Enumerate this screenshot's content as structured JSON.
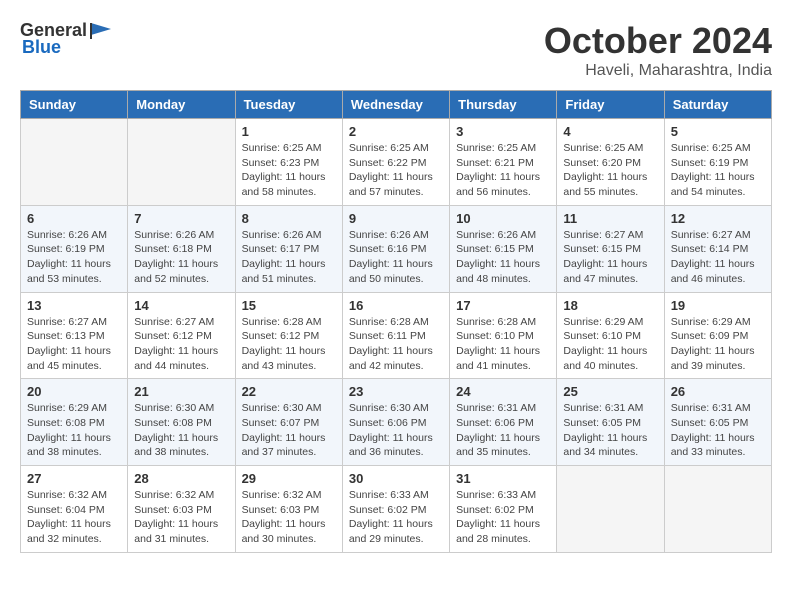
{
  "header": {
    "logo_general": "General",
    "logo_blue": "Blue",
    "title": "October 2024",
    "subtitle": "Haveli, Maharashtra, India"
  },
  "calendar": {
    "weekdays": [
      "Sunday",
      "Monday",
      "Tuesday",
      "Wednesday",
      "Thursday",
      "Friday",
      "Saturday"
    ],
    "weeks": [
      [
        {
          "day": "",
          "sunrise": "",
          "sunset": "",
          "daylight": ""
        },
        {
          "day": "",
          "sunrise": "",
          "sunset": "",
          "daylight": ""
        },
        {
          "day": "1",
          "sunrise": "Sunrise: 6:25 AM",
          "sunset": "Sunset: 6:23 PM",
          "daylight": "Daylight: 11 hours and 58 minutes."
        },
        {
          "day": "2",
          "sunrise": "Sunrise: 6:25 AM",
          "sunset": "Sunset: 6:22 PM",
          "daylight": "Daylight: 11 hours and 57 minutes."
        },
        {
          "day": "3",
          "sunrise": "Sunrise: 6:25 AM",
          "sunset": "Sunset: 6:21 PM",
          "daylight": "Daylight: 11 hours and 56 minutes."
        },
        {
          "day": "4",
          "sunrise": "Sunrise: 6:25 AM",
          "sunset": "Sunset: 6:20 PM",
          "daylight": "Daylight: 11 hours and 55 minutes."
        },
        {
          "day": "5",
          "sunrise": "Sunrise: 6:25 AM",
          "sunset": "Sunset: 6:19 PM",
          "daylight": "Daylight: 11 hours and 54 minutes."
        }
      ],
      [
        {
          "day": "6",
          "sunrise": "Sunrise: 6:26 AM",
          "sunset": "Sunset: 6:19 PM",
          "daylight": "Daylight: 11 hours and 53 minutes."
        },
        {
          "day": "7",
          "sunrise": "Sunrise: 6:26 AM",
          "sunset": "Sunset: 6:18 PM",
          "daylight": "Daylight: 11 hours and 52 minutes."
        },
        {
          "day": "8",
          "sunrise": "Sunrise: 6:26 AM",
          "sunset": "Sunset: 6:17 PM",
          "daylight": "Daylight: 11 hours and 51 minutes."
        },
        {
          "day": "9",
          "sunrise": "Sunrise: 6:26 AM",
          "sunset": "Sunset: 6:16 PM",
          "daylight": "Daylight: 11 hours and 50 minutes."
        },
        {
          "day": "10",
          "sunrise": "Sunrise: 6:26 AM",
          "sunset": "Sunset: 6:15 PM",
          "daylight": "Daylight: 11 hours and 48 minutes."
        },
        {
          "day": "11",
          "sunrise": "Sunrise: 6:27 AM",
          "sunset": "Sunset: 6:15 PM",
          "daylight": "Daylight: 11 hours and 47 minutes."
        },
        {
          "day": "12",
          "sunrise": "Sunrise: 6:27 AM",
          "sunset": "Sunset: 6:14 PM",
          "daylight": "Daylight: 11 hours and 46 minutes."
        }
      ],
      [
        {
          "day": "13",
          "sunrise": "Sunrise: 6:27 AM",
          "sunset": "Sunset: 6:13 PM",
          "daylight": "Daylight: 11 hours and 45 minutes."
        },
        {
          "day": "14",
          "sunrise": "Sunrise: 6:27 AM",
          "sunset": "Sunset: 6:12 PM",
          "daylight": "Daylight: 11 hours and 44 minutes."
        },
        {
          "day": "15",
          "sunrise": "Sunrise: 6:28 AM",
          "sunset": "Sunset: 6:12 PM",
          "daylight": "Daylight: 11 hours and 43 minutes."
        },
        {
          "day": "16",
          "sunrise": "Sunrise: 6:28 AM",
          "sunset": "Sunset: 6:11 PM",
          "daylight": "Daylight: 11 hours and 42 minutes."
        },
        {
          "day": "17",
          "sunrise": "Sunrise: 6:28 AM",
          "sunset": "Sunset: 6:10 PM",
          "daylight": "Daylight: 11 hours and 41 minutes."
        },
        {
          "day": "18",
          "sunrise": "Sunrise: 6:29 AM",
          "sunset": "Sunset: 6:10 PM",
          "daylight": "Daylight: 11 hours and 40 minutes."
        },
        {
          "day": "19",
          "sunrise": "Sunrise: 6:29 AM",
          "sunset": "Sunset: 6:09 PM",
          "daylight": "Daylight: 11 hours and 39 minutes."
        }
      ],
      [
        {
          "day": "20",
          "sunrise": "Sunrise: 6:29 AM",
          "sunset": "Sunset: 6:08 PM",
          "daylight": "Daylight: 11 hours and 38 minutes."
        },
        {
          "day": "21",
          "sunrise": "Sunrise: 6:30 AM",
          "sunset": "Sunset: 6:08 PM",
          "daylight": "Daylight: 11 hours and 38 minutes."
        },
        {
          "day": "22",
          "sunrise": "Sunrise: 6:30 AM",
          "sunset": "Sunset: 6:07 PM",
          "daylight": "Daylight: 11 hours and 37 minutes."
        },
        {
          "day": "23",
          "sunrise": "Sunrise: 6:30 AM",
          "sunset": "Sunset: 6:06 PM",
          "daylight": "Daylight: 11 hours and 36 minutes."
        },
        {
          "day": "24",
          "sunrise": "Sunrise: 6:31 AM",
          "sunset": "Sunset: 6:06 PM",
          "daylight": "Daylight: 11 hours and 35 minutes."
        },
        {
          "day": "25",
          "sunrise": "Sunrise: 6:31 AM",
          "sunset": "Sunset: 6:05 PM",
          "daylight": "Daylight: 11 hours and 34 minutes."
        },
        {
          "day": "26",
          "sunrise": "Sunrise: 6:31 AM",
          "sunset": "Sunset: 6:05 PM",
          "daylight": "Daylight: 11 hours and 33 minutes."
        }
      ],
      [
        {
          "day": "27",
          "sunrise": "Sunrise: 6:32 AM",
          "sunset": "Sunset: 6:04 PM",
          "daylight": "Daylight: 11 hours and 32 minutes."
        },
        {
          "day": "28",
          "sunrise": "Sunrise: 6:32 AM",
          "sunset": "Sunset: 6:03 PM",
          "daylight": "Daylight: 11 hours and 31 minutes."
        },
        {
          "day": "29",
          "sunrise": "Sunrise: 6:32 AM",
          "sunset": "Sunset: 6:03 PM",
          "daylight": "Daylight: 11 hours and 30 minutes."
        },
        {
          "day": "30",
          "sunrise": "Sunrise: 6:33 AM",
          "sunset": "Sunset: 6:02 PM",
          "daylight": "Daylight: 11 hours and 29 minutes."
        },
        {
          "day": "31",
          "sunrise": "Sunrise: 6:33 AM",
          "sunset": "Sunset: 6:02 PM",
          "daylight": "Daylight: 11 hours and 28 minutes."
        },
        {
          "day": "",
          "sunrise": "",
          "sunset": "",
          "daylight": ""
        },
        {
          "day": "",
          "sunrise": "",
          "sunset": "",
          "daylight": ""
        }
      ]
    ]
  }
}
